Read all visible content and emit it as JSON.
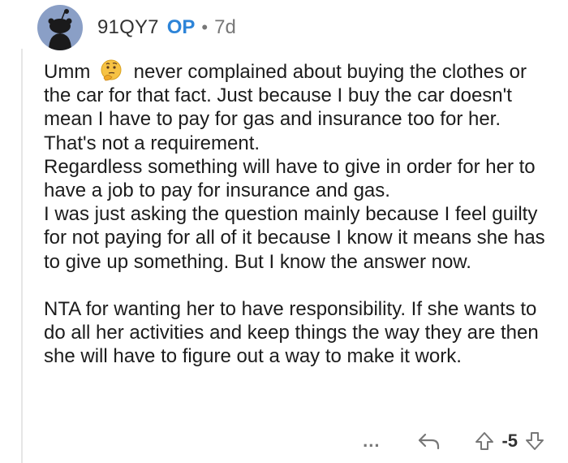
{
  "comment": {
    "username": "91QY7",
    "op_badge": "OP",
    "separator": "•",
    "age": "7d",
    "paragraphs": [
      "Umm never complained about buying the clothes or the car for that fact.  Just because I buy the car doesn't mean I have to pay for gas and insurance too for her.  That's not a requirement.",
      "Regardless something will have to give in order for her to have a job to pay for insurance and gas.",
      "I was just asking the question mainly because I feel guilty for not paying for all of it because I know it means she has to give up something.  But I know the answer now.",
      "NTA for wanting her to have responsibility.  If she wants to do all her activities and keep things the way they are then she will have to figure out a way to make it work."
    ],
    "paragraph1_before_emoji": "Umm",
    "paragraph1_after_emoji": "never complained about buying the clothes or the car for that fact.  Just because I buy the car doesn't mean I have to pay for gas and insurance too for her.  That's not a requirement.",
    "emoji": "thinking-face-icon"
  },
  "actions": {
    "more_label": "...",
    "vote_count": "-5",
    "icons": [
      "reply-icon",
      "upvote-icon",
      "downvote-icon"
    ]
  },
  "colors": {
    "op_badge": "#2d84d8",
    "meta_text": "#777777",
    "body_text": "#1c1c1c",
    "avatar_bg": "#8a9fc6"
  }
}
